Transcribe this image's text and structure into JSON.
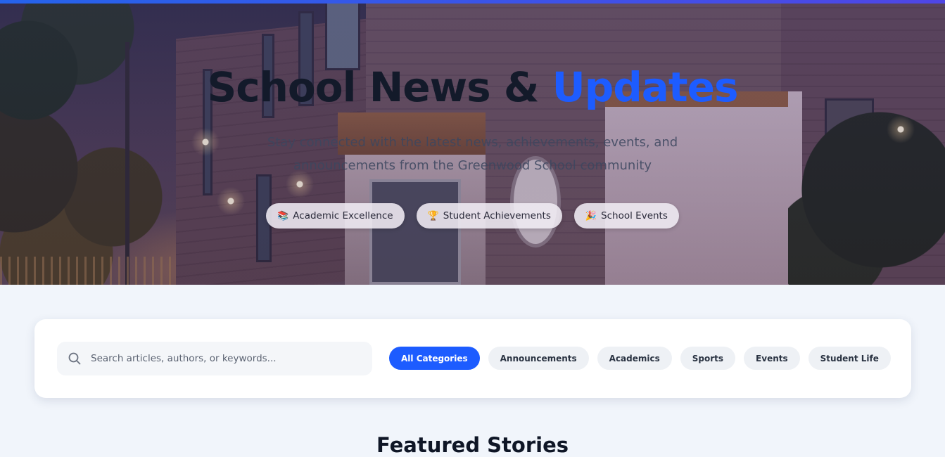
{
  "hero": {
    "title_main": "School News & ",
    "title_accent": "Updates",
    "subtitle": "Stay connected with the latest news, achievements, events, and announcements from the Greenwood School community",
    "pills": [
      {
        "icon": "books-icon",
        "glyph": "📚",
        "label": "Academic Excellence"
      },
      {
        "icon": "trophy-icon",
        "glyph": "🏆",
        "label": "Student Achievements"
      },
      {
        "icon": "party-icon",
        "glyph": "🎉",
        "label": "School Events"
      }
    ]
  },
  "filters": {
    "search_placeholder": "Search articles, authors, or keywords...",
    "search_value": "",
    "categories": [
      "All Categories",
      "Announcements",
      "Academics",
      "Sports",
      "Events",
      "Student Life"
    ],
    "active_category": "All Categories"
  },
  "section": {
    "featured_title": "Featured Stories"
  },
  "colors": {
    "accent": "#1d5cff",
    "top_bar": "#2563eb",
    "page_bg": "#f1f5fb"
  }
}
